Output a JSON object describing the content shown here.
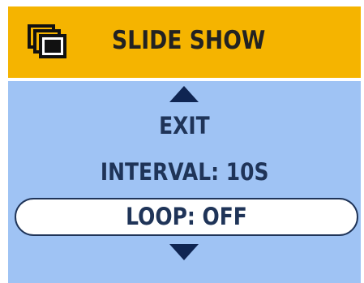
{
  "header": {
    "icon": "slideshow-stack-icon",
    "title": "SLIDE SHOW",
    "background_color": "#f5b400"
  },
  "menu": {
    "background_color": "#9fc3f4",
    "scroll_up_icon": "arrow-up-icon",
    "scroll_down_icon": "arrow-down-icon",
    "items": [
      {
        "label": "EXIT",
        "selected": false
      },
      {
        "label": "INTERVAL: 10S",
        "selected": false
      },
      {
        "label": "LOOP: OFF",
        "selected": true
      }
    ]
  }
}
